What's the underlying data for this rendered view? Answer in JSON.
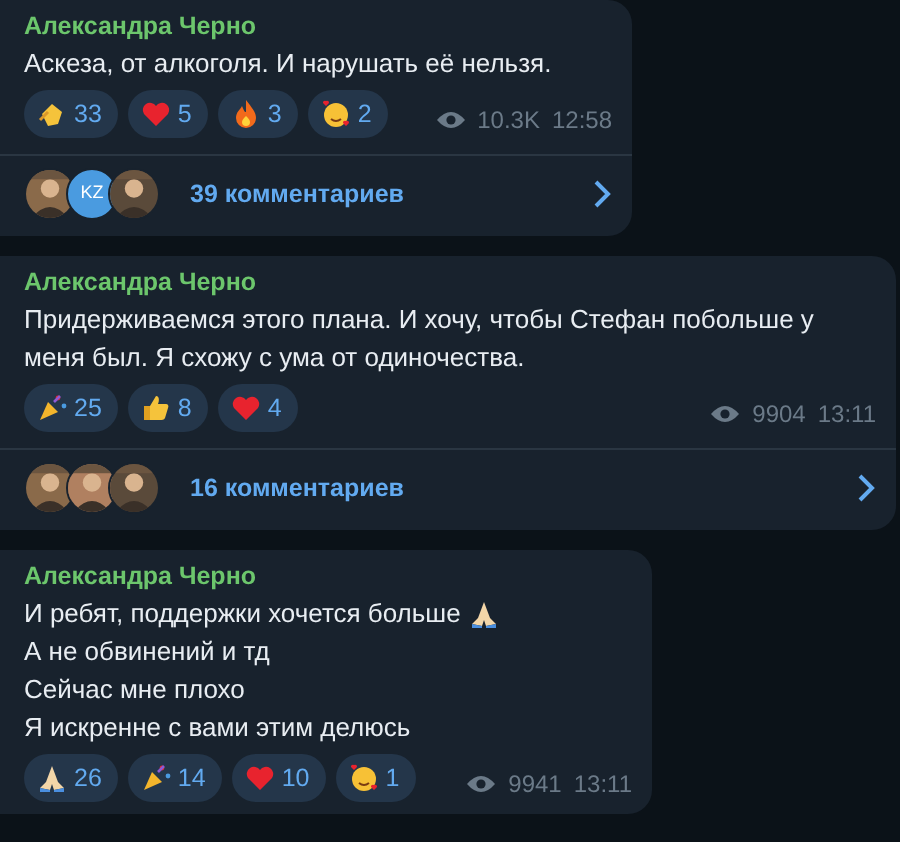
{
  "messages": [
    {
      "author": "Александра Черно",
      "lines": [
        "Аскеза, от алкоголя. И нарушать её нельзя."
      ],
      "reactions": [
        {
          "kind": "clap",
          "count": "33"
        },
        {
          "kind": "heart",
          "count": "5"
        },
        {
          "kind": "fire",
          "count": "3"
        },
        {
          "kind": "love-face",
          "count": "2"
        }
      ],
      "views": "10.3K",
      "time": "12:58",
      "comments": {
        "avatars": [
          {
            "kind": "picture"
          },
          {
            "kind": "initials",
            "text": "KZ"
          },
          {
            "kind": "picture"
          }
        ],
        "label": "39 комментариев"
      }
    },
    {
      "author": "Александра Черно",
      "lines": [
        "Придерживаемся этого плана. И хочу, чтобы Стефан побольше у меня был. Я схожу с ума от одиночества."
      ],
      "reactions": [
        {
          "kind": "party",
          "count": "25"
        },
        {
          "kind": "thumbs-up",
          "count": "8"
        },
        {
          "kind": "heart",
          "count": "4"
        }
      ],
      "views": "9904",
      "time": "13:11",
      "comments": {
        "avatars": [
          {
            "kind": "picture"
          },
          {
            "kind": "picture"
          },
          {
            "kind": "picture"
          }
        ],
        "label": "16 комментариев"
      }
    },
    {
      "author": "Александра Черно",
      "lines": [
        {
          "text": "И ребят, поддержки хочется больше",
          "kind": "pray"
        },
        "А не обвинений и тд",
        "Сейчас мне плохо",
        "Я искренне с вами этим делюсь"
      ],
      "reactions": [
        {
          "kind": "pray",
          "count": "26"
        },
        {
          "kind": "party",
          "count": "14"
        },
        {
          "kind": "heart",
          "count": "10"
        },
        {
          "kind": "love-face",
          "count": "1"
        }
      ],
      "views": "9941",
      "time": "13:11"
    }
  ]
}
